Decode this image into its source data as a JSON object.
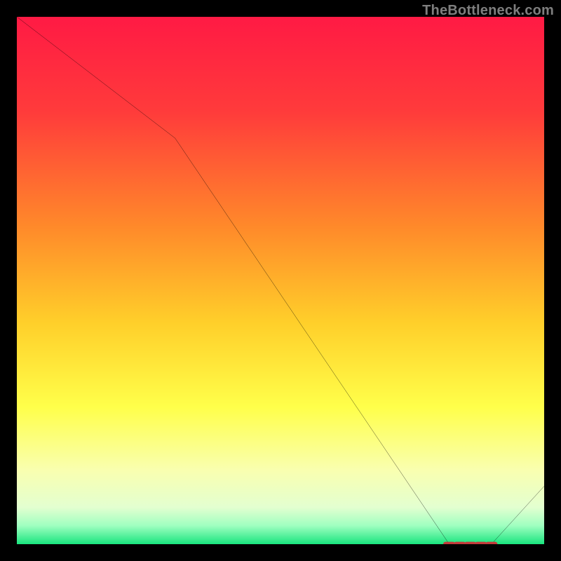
{
  "attribution": "TheBottleneck.com",
  "chart_data": {
    "type": "line",
    "title": "",
    "xlabel": "",
    "ylabel": "",
    "xlim": [
      0,
      100
    ],
    "ylim": [
      0,
      100
    ],
    "series": [
      {
        "name": "bottleneck-curve",
        "x": [
          0,
          30,
          82,
          90,
          100
        ],
        "y": [
          100,
          77,
          0,
          0,
          11
        ]
      }
    ],
    "markers": {
      "name": "trough-markers",
      "color": "#c43a3a",
      "x": [
        82,
        84,
        86,
        88,
        90
      ],
      "y": [
        0,
        0,
        0,
        0,
        0
      ]
    },
    "gradient_stops": [
      {
        "offset": 0,
        "color": "#ff1a44"
      },
      {
        "offset": 0.18,
        "color": "#ff3b3b"
      },
      {
        "offset": 0.4,
        "color": "#ff8a2a"
      },
      {
        "offset": 0.58,
        "color": "#ffcf2a"
      },
      {
        "offset": 0.74,
        "color": "#ffff4a"
      },
      {
        "offset": 0.86,
        "color": "#f9ffb0"
      },
      {
        "offset": 0.93,
        "color": "#e3ffd0"
      },
      {
        "offset": 0.965,
        "color": "#9fffc0"
      },
      {
        "offset": 1.0,
        "color": "#19e57e"
      }
    ]
  }
}
